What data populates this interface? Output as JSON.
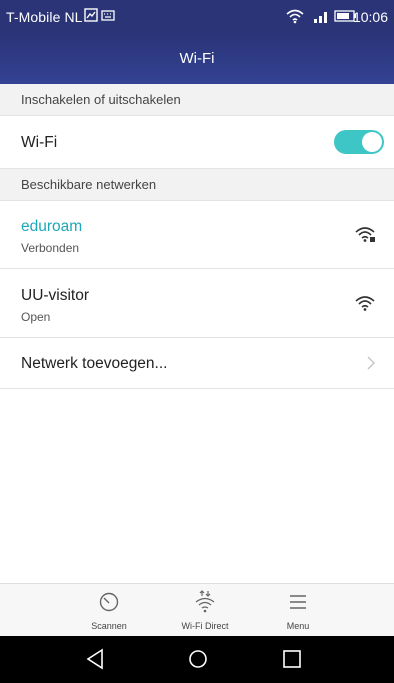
{
  "status_bar": {
    "carrier": "T-Mobile NL",
    "time": "10:06"
  },
  "header": {
    "title": "Wi-Fi"
  },
  "sections": {
    "toggle_section": "Inschakelen of uitschakelen",
    "networks_section": "Beschikbare netwerken"
  },
  "wifi_toggle": {
    "label": "Wi-Fi",
    "state": "on",
    "accent_color": "#3ec6c6"
  },
  "networks": [
    {
      "name": "eduroam",
      "status": "Verbonden",
      "connected": true,
      "name_color": "#1ca7b8",
      "icon": "wifi-secured-icon"
    },
    {
      "name": "UU-visitor",
      "status": "Open",
      "connected": false,
      "icon": "wifi-icon"
    }
  ],
  "add_network": {
    "label": "Netwerk toevoegen..."
  },
  "toolbar": {
    "scan_label": "Scannen",
    "wifi_direct_label": "Wi-Fi Direct",
    "menu_label": "Menu"
  },
  "navigation": {
    "back": "back-icon",
    "home": "home-icon",
    "recents": "recents-icon"
  }
}
